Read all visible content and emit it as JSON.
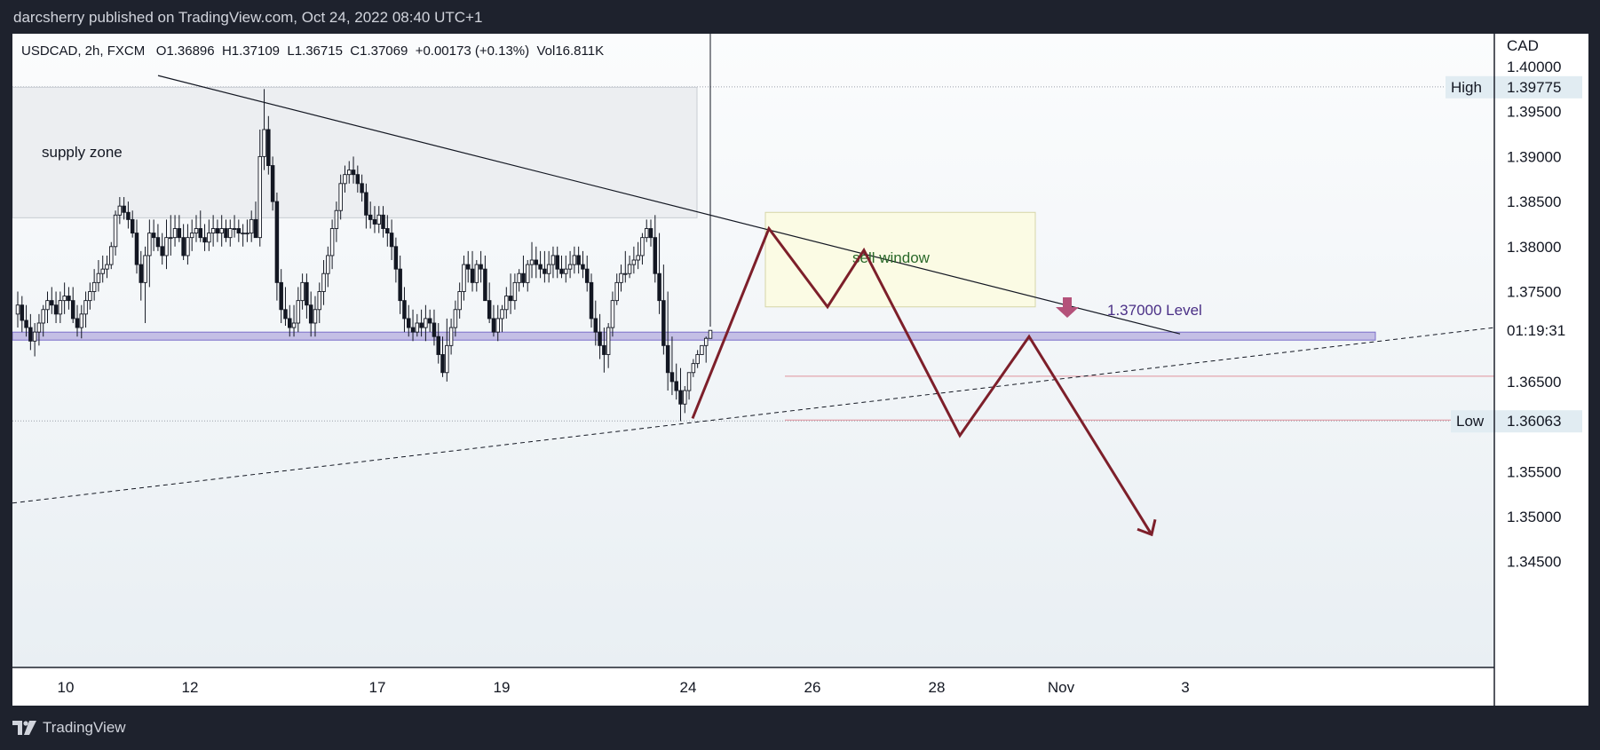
{
  "header": {
    "publish_line": "darcsherry published on TradingView.com, Oct 24, 2022 08:40 UTC+1"
  },
  "legend": {
    "symbol": "USDCAD, 2h, FXCM",
    "open": "O1.36896",
    "high": "H1.37109",
    "low": "L1.36715",
    "close": "C1.37069",
    "change": "+0.00173 (+0.13%)",
    "volume": "Vol16.811K"
  },
  "footer": {
    "brand": "TradingView",
    "logo_icon": "tradingview-logo-icon"
  },
  "price_axis": {
    "currency": "CAD",
    "countdown": "01:19:31",
    "high_label": "High",
    "high_value": "1.39775",
    "low_label": "Low",
    "low_value": "1.36063"
  },
  "annotations": {
    "supply_zone": "supply zone",
    "sell_window": "sell window",
    "level_label": "1.37000 Level"
  },
  "colors": {
    "background_top": "#fbfcfd",
    "background_bottom": "#e9eff3",
    "candle_color": "#131722",
    "supply_zone_fill": "#eceef1",
    "sell_window_fill": "#fbfbe4",
    "level_band_fill": "#b8b2e0",
    "level_band_stroke": "#7b6fc9",
    "projection_color": "#7d1f2a",
    "marker_arrow": "#b4527a",
    "level_text": "#4a2f86",
    "sell_window_text": "#2b6a2a",
    "low_line": "#e0909c"
  },
  "chart_data": {
    "type": "candlestick",
    "timeframe": "2h",
    "x_axis": {
      "ticks": [
        "10",
        "12",
        "17",
        "19",
        "24",
        "26",
        "28",
        "Nov",
        "3"
      ]
    },
    "y_axis": {
      "ticks": [
        "1.40000",
        "1.39500",
        "1.39000",
        "1.38500",
        "1.38000",
        "1.37500",
        "1.36500",
        "1.35500",
        "1.35000",
        "1.34500"
      ],
      "range": [
        1.3415,
        1.403
      ]
    },
    "ohlc": {
      "open": 1.36896,
      "high": 1.37109,
      "low": 1.36715,
      "close": 1.37069
    },
    "period_high": 1.39775,
    "period_low": 1.36063,
    "key_level": 1.37,
    "supply_zone": {
      "from": "Oct 9",
      "to": "Oct 24",
      "price_low": 1.3832,
      "price_high": 1.3977
    },
    "sell_window_zone": {
      "from": "Oct 25",
      "to": "Oct 31",
      "price_low": 1.3733,
      "price_high": 1.3838
    },
    "descending_trendline": {
      "from": [
        "Oct 11",
        1.399
      ],
      "to": [
        "Nov 2",
        1.3703
      ]
    },
    "ascending_trendline": {
      "from": [
        "Oct 9",
        1.3515
      ],
      "to": [
        "Nov 3",
        1.371
      ]
    },
    "projected_path": {
      "x": [
        "Oct 24",
        "Oct 25",
        "Oct 26",
        "Oct 26",
        "Oct 28",
        "Oct 29",
        "Nov 2"
      ],
      "y": [
        1.3609,
        1.382,
        1.3733,
        1.3796,
        1.359,
        1.37,
        1.348
      ]
    },
    "candles": {
      "comment_unit": "open/high/low/close in CAD",
      "open": [
        1.3725,
        1.3735,
        1.3718,
        1.371,
        1.3695,
        1.3705,
        1.3715,
        1.373,
        1.374,
        1.3735,
        1.3725,
        1.374,
        1.3745,
        1.374,
        1.372,
        1.371,
        1.3725,
        1.374,
        1.375,
        1.376,
        1.377,
        1.3775,
        1.378,
        1.38,
        1.3835,
        1.3845,
        1.3838,
        1.383,
        1.3815,
        1.378,
        1.376,
        1.379,
        1.3815,
        1.381,
        1.38,
        1.379,
        1.381,
        1.381,
        1.382,
        1.381,
        1.379,
        1.381,
        1.3815,
        1.382,
        1.381,
        1.3805,
        1.3815,
        1.382,
        1.3815,
        1.382,
        1.381,
        1.382,
        1.382,
        1.3815,
        1.3815,
        1.3815,
        1.383,
        1.381,
        1.39,
        1.393,
        1.389,
        1.385,
        1.376,
        1.373,
        1.372,
        1.371,
        1.3715,
        1.374,
        1.376,
        1.3735,
        1.3715,
        1.373,
        1.375,
        1.377,
        1.379,
        1.382,
        1.384,
        1.387,
        1.388,
        1.3885,
        1.388,
        1.387,
        1.386,
        1.3835,
        1.383,
        1.3825,
        1.3835,
        1.382,
        1.3815,
        1.38,
        1.3775,
        1.374,
        1.372,
        1.371,
        1.3705,
        1.3715,
        1.371,
        1.372,
        1.3715,
        1.37,
        1.368,
        1.366,
        1.369,
        1.371,
        1.373,
        1.375,
        1.378,
        1.3775,
        1.376,
        1.378,
        1.3775,
        1.374,
        1.372,
        1.3705,
        1.372,
        1.373,
        1.3745,
        1.374,
        1.376,
        1.377,
        1.376,
        1.378,
        1.3785,
        1.378,
        1.3775,
        1.377,
        1.378,
        1.379,
        1.3775,
        1.377,
        1.3775,
        1.378,
        1.379,
        1.378,
        1.3775,
        1.376,
        1.372,
        1.3705,
        1.369,
        1.368,
        1.371,
        1.374,
        1.376,
        1.377,
        1.377,
        1.378,
        1.3785,
        1.379,
        1.381,
        1.382,
        1.381,
        1.377,
        1.374,
        1.369,
        1.366,
        1.365,
        1.364,
        1.3625,
        1.364,
        1.366,
        1.367,
        1.368,
        1.369,
        1.3698
      ],
      "high": [
        1.375,
        1.3745,
        1.3735,
        1.3725,
        1.3715,
        1.3725,
        1.3735,
        1.375,
        1.3755,
        1.375,
        1.375,
        1.376,
        1.3755,
        1.3755,
        1.3735,
        1.3735,
        1.375,
        1.376,
        1.3775,
        1.3785,
        1.379,
        1.379,
        1.3805,
        1.384,
        1.3855,
        1.3855,
        1.385,
        1.384,
        1.383,
        1.3795,
        1.38,
        1.383,
        1.383,
        1.3825,
        1.3815,
        1.383,
        1.3835,
        1.3835,
        1.3835,
        1.3825,
        1.3825,
        1.383,
        1.3835,
        1.384,
        1.3825,
        1.383,
        1.3835,
        1.383,
        1.3835,
        1.383,
        1.383,
        1.3835,
        1.383,
        1.3825,
        1.383,
        1.384,
        1.385,
        1.393,
        1.3975,
        1.3945,
        1.39,
        1.386,
        1.3775,
        1.3755,
        1.3735,
        1.3735,
        1.3755,
        1.377,
        1.377,
        1.375,
        1.3745,
        1.376,
        1.3785,
        1.38,
        1.383,
        1.385,
        1.388,
        1.389,
        1.3895,
        1.39,
        1.389,
        1.388,
        1.387,
        1.385,
        1.3845,
        1.3845,
        1.3845,
        1.3835,
        1.383,
        1.381,
        1.379,
        1.3755,
        1.3735,
        1.373,
        1.3725,
        1.373,
        1.3735,
        1.373,
        1.373,
        1.3715,
        1.37,
        1.372,
        1.372,
        1.374,
        1.376,
        1.379,
        1.3795,
        1.3795,
        1.3785,
        1.3795,
        1.379,
        1.376,
        1.3735,
        1.3735,
        1.3735,
        1.3755,
        1.377,
        1.377,
        1.3775,
        1.379,
        1.3785,
        1.3805,
        1.38,
        1.3795,
        1.3795,
        1.3795,
        1.38,
        1.38,
        1.379,
        1.379,
        1.3795,
        1.38,
        1.38,
        1.3795,
        1.379,
        1.377,
        1.374,
        1.3725,
        1.371,
        1.3715,
        1.375,
        1.377,
        1.378,
        1.3795,
        1.379,
        1.38,
        1.3805,
        1.3815,
        1.383,
        1.383,
        1.3835,
        1.3815,
        1.378,
        1.375,
        1.37,
        1.367,
        1.3665,
        1.3645,
        1.365,
        1.3675,
        1.3685,
        1.369,
        1.37,
        1.3711
      ],
      "low": [
        1.371,
        1.3705,
        1.37,
        1.3685,
        1.3678,
        1.369,
        1.37,
        1.3715,
        1.3725,
        1.3715,
        1.3715,
        1.3725,
        1.373,
        1.3715,
        1.37,
        1.3698,
        1.371,
        1.373,
        1.374,
        1.375,
        1.376,
        1.3765,
        1.3775,
        1.379,
        1.3825,
        1.383,
        1.382,
        1.381,
        1.377,
        1.374,
        1.3715,
        1.3755,
        1.3795,
        1.3795,
        1.378,
        1.3775,
        1.379,
        1.38,
        1.3805,
        1.3785,
        1.378,
        1.3795,
        1.3805,
        1.3805,
        1.3795,
        1.3795,
        1.38,
        1.3805,
        1.38,
        1.3805,
        1.38,
        1.381,
        1.3805,
        1.38,
        1.3805,
        1.3805,
        1.381,
        1.38,
        1.3885,
        1.388,
        1.384,
        1.374,
        1.3715,
        1.3712,
        1.37,
        1.37,
        1.3705,
        1.373,
        1.372,
        1.37,
        1.37,
        1.3715,
        1.3735,
        1.3755,
        1.3775,
        1.3805,
        1.383,
        1.386,
        1.387,
        1.387,
        1.386,
        1.385,
        1.382,
        1.382,
        1.3815,
        1.3815,
        1.381,
        1.38,
        1.3785,
        1.376,
        1.3725,
        1.3705,
        1.37,
        1.3695,
        1.37,
        1.37,
        1.3695,
        1.3705,
        1.369,
        1.367,
        1.3655,
        1.365,
        1.368,
        1.37,
        1.372,
        1.374,
        1.376,
        1.375,
        1.375,
        1.376,
        1.374,
        1.3715,
        1.37,
        1.3695,
        1.3705,
        1.372,
        1.3725,
        1.373,
        1.375,
        1.3755,
        1.375,
        1.3765,
        1.3765,
        1.3765,
        1.376,
        1.376,
        1.3765,
        1.3765,
        1.3765,
        1.376,
        1.3765,
        1.377,
        1.377,
        1.3765,
        1.375,
        1.371,
        1.369,
        1.3675,
        1.366,
        1.3665,
        1.37,
        1.3735,
        1.375,
        1.376,
        1.3765,
        1.377,
        1.3775,
        1.378,
        1.3805,
        1.38,
        1.376,
        1.3725,
        1.368,
        1.364,
        1.3635,
        1.363,
        1.3606,
        1.3615,
        1.363,
        1.3655,
        1.3665,
        1.368,
        1.3671
      ],
      "close": [
        1.3735,
        1.3718,
        1.371,
        1.3695,
        1.3705,
        1.3715,
        1.373,
        1.374,
        1.3735,
        1.3725,
        1.374,
        1.3745,
        1.374,
        1.372,
        1.371,
        1.3725,
        1.374,
        1.375,
        1.376,
        1.377,
        1.3775,
        1.378,
        1.38,
        1.3835,
        1.3845,
        1.3838,
        1.383,
        1.3815,
        1.378,
        1.376,
        1.379,
        1.3815,
        1.381,
        1.38,
        1.379,
        1.381,
        1.381,
        1.382,
        1.381,
        1.379,
        1.381,
        1.3815,
        1.382,
        1.381,
        1.3805,
        1.3815,
        1.382,
        1.3815,
        1.382,
        1.381,
        1.382,
        1.382,
        1.3815,
        1.3815,
        1.3815,
        1.383,
        1.381,
        1.39,
        1.393,
        1.389,
        1.385,
        1.376,
        1.373,
        1.372,
        1.371,
        1.3715,
        1.374,
        1.376,
        1.3735,
        1.3715,
        1.373,
        1.375,
        1.377,
        1.379,
        1.382,
        1.384,
        1.387,
        1.388,
        1.3885,
        1.388,
        1.387,
        1.386,
        1.3835,
        1.383,
        1.3825,
        1.3835,
        1.382,
        1.3815,
        1.38,
        1.3775,
        1.374,
        1.372,
        1.371,
        1.3705,
        1.3715,
        1.371,
        1.372,
        1.3715,
        1.37,
        1.368,
        1.366,
        1.369,
        1.371,
        1.373,
        1.375,
        1.378,
        1.3775,
        1.376,
        1.378,
        1.3775,
        1.374,
        1.372,
        1.3705,
        1.372,
        1.373,
        1.3745,
        1.374,
        1.376,
        1.377,
        1.376,
        1.378,
        1.3785,
        1.378,
        1.3775,
        1.377,
        1.378,
        1.379,
        1.3775,
        1.377,
        1.3775,
        1.378,
        1.379,
        1.378,
        1.3775,
        1.376,
        1.372,
        1.3705,
        1.369,
        1.368,
        1.371,
        1.374,
        1.376,
        1.377,
        1.377,
        1.378,
        1.3785,
        1.379,
        1.381,
        1.382,
        1.381,
        1.377,
        1.374,
        1.369,
        1.366,
        1.365,
        1.364,
        1.3625,
        1.364,
        1.366,
        1.367,
        1.368,
        1.369,
        1.3698,
        1.37069
      ]
    }
  }
}
